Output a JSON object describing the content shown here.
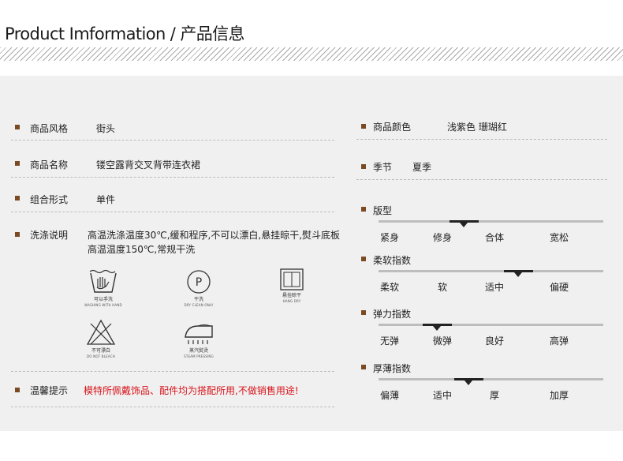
{
  "header": {
    "title": "Product Imformation / 产品信息"
  },
  "left": {
    "style_label": "商品风格",
    "style_value": "街头",
    "name_label": "商品名称",
    "name_value": "镂空露背交叉背带连衣裙",
    "combo_label": "组合形式",
    "combo_value": "单件",
    "wash_label": "洗涤说明",
    "wash_text": "高温洗涤温度30℃,缓和程序,不可以漂白,悬挂晾干,熨斗底板高温温度150℃,常规干洗",
    "icons": [
      {
        "name": "hand-wash-icon",
        "cn": "可以手洗",
        "en": "WASHING WITH HAND"
      },
      {
        "name": "dry-clean-icon",
        "cn": "干洗",
        "en": "DRY CLEAN ONLY",
        "glyph": "P"
      },
      {
        "name": "hang-dry-icon",
        "cn": "悬挂晾干",
        "en": "HANG DRY"
      },
      {
        "name": "no-bleach-icon",
        "cn": "不可漂白",
        "en": "DO NOT BLEACH"
      },
      {
        "name": "steam-iron-icon",
        "cn": "蒸汽熨烫",
        "en": "STEAM PRESSING"
      }
    ],
    "tip_label": "温馨提示",
    "tip_text": "模特所佩戴饰品、配件均为搭配所用,不做销售用途!"
  },
  "right": {
    "color_label": "商品颜色",
    "color_value": "浅紫色 珊瑚红",
    "season_label": "季节",
    "season_value": "夏季",
    "scales": [
      {
        "label": "版型",
        "options": [
          "紧身",
          "修身",
          "合体",
          "宽松"
        ],
        "selected": "修身",
        "marker_pos": 0.38
      },
      {
        "label": "柔软指数",
        "options": [
          "柔软",
          "软",
          "适中",
          "偏硬"
        ],
        "selected": "适中",
        "marker_pos": 0.62
      },
      {
        "label": "弹力指数",
        "options": [
          "无弹",
          "微弹",
          "良好",
          "高弹"
        ],
        "selected": "微弹",
        "marker_pos": 0.26
      },
      {
        "label": "厚薄指数",
        "options": [
          "偏薄",
          "适中",
          "厚",
          "加厚"
        ],
        "selected": "适中",
        "marker_pos": 0.4
      }
    ]
  },
  "colors": {
    "bullet": "#7a4a22",
    "warning": "#d8141b",
    "panel": "#f0f0f0"
  }
}
